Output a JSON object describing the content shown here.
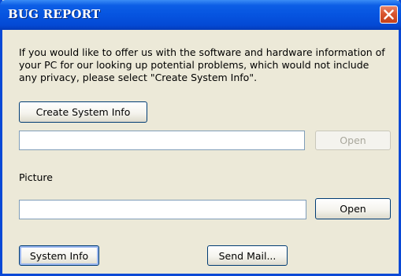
{
  "window": {
    "title": "BUG REPORT",
    "close_icon": "close-icon"
  },
  "description": "If you would like to offer us with the software and hardware information of your PC for our looking up potential problems, which would not include any privacy, please select \"Create System Info\".",
  "system_info_section": {
    "create_button_label": "Create System Info",
    "path_value": "",
    "open_button_label": "Open",
    "open_button_enabled": false
  },
  "picture_section": {
    "label": "Picture",
    "path_value": "",
    "open_button_label": "Open",
    "open_button_enabled": true
  },
  "footer": {
    "system_info_button_label": "System Info",
    "send_mail_button_label": "Send Mail..."
  },
  "colors": {
    "titlebar": "#0654e0",
    "window_bg": "#ece9d8",
    "close_button": "#d9552f",
    "button_border": "#003c74",
    "input_border": "#7f9db9"
  }
}
